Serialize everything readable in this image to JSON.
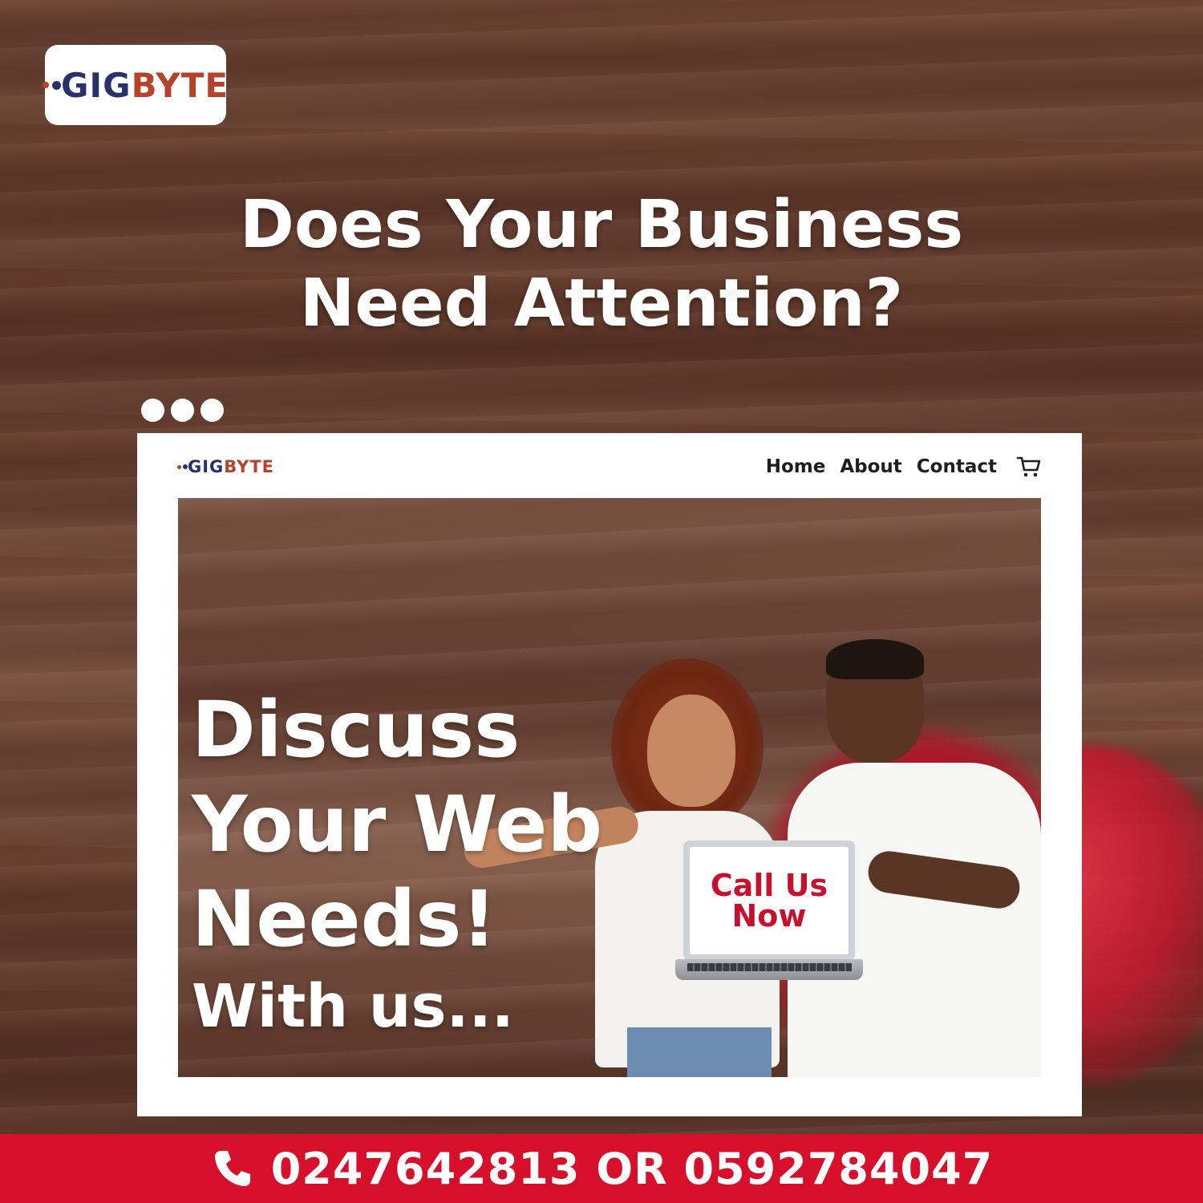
{
  "brand": {
    "gig": "GIG",
    "byte": "BYTE"
  },
  "headline": {
    "line1": "Does Your Business",
    "line2": "Need Attention?"
  },
  "browser": {
    "nav": [
      {
        "label": "Home"
      },
      {
        "label": "About"
      },
      {
        "label": "Contact"
      }
    ],
    "cart_icon": "cart-icon"
  },
  "hero": {
    "title_line1": "Discuss",
    "title_line2": "Your Web",
    "title_line3": "Needs!",
    "subtitle": "With us...",
    "cta_line1": "Call Us",
    "cta_line2": "Now"
  },
  "contact": {
    "phone_icon": "phone-icon",
    "text": "0247642813 OR 0592784047"
  },
  "colors": {
    "brand_navy": "#2a3069",
    "brand_orange": "#b5432a",
    "accent_red": "#d6102b",
    "cta_red": "#c8102e"
  }
}
